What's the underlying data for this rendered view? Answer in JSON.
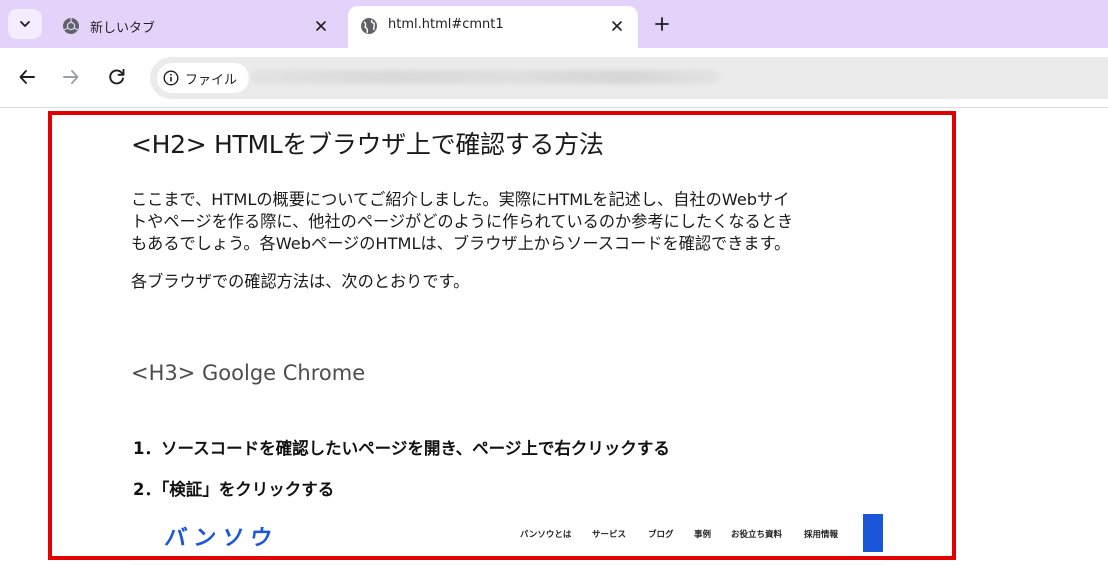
{
  "browser": {
    "tabs": [
      {
        "title": "新しいタブ",
        "icon": "chrome-icon",
        "active": false
      },
      {
        "title": "html.html#cmnt1",
        "icon": "globe-icon",
        "active": true
      }
    ],
    "new_tab_label": "+",
    "security_chip_label": "ファイル",
    "colors": {
      "tabstrip": "#e3d3fb",
      "omnibox": "#ebebeb",
      "highlight": "#e20000"
    }
  },
  "article": {
    "h2": "<H2> HTMLをブラウザ上で確認する方法",
    "para1_lines": [
      "ここまで、HTMLの概要についてご紹介しました。実際にHTMLを記述し、自社のWebサイ",
      "トやページを作る際に、他社のページがどのように作られているのか参考にしたくなるとき",
      "もあるでしょう。各WebページのHTMLは、ブラウザ上からソースコードを確認できます。"
    ],
    "para2": "各ブラウザでの確認方法は、次のとおりです。",
    "h3": "<H3> Goolge Chrome",
    "steps": [
      "1．ソースコードを確認したいページを開き、ページ上で右クリックする",
      "2．「検証」をクリックする"
    ]
  },
  "embedded_site": {
    "logo": "バンソウ",
    "nav": [
      "バンソウとは",
      "サービス",
      "ブログ",
      "事例",
      "お役立ち資料",
      "採用情報"
    ],
    "brand_color": "#1c56d8"
  }
}
